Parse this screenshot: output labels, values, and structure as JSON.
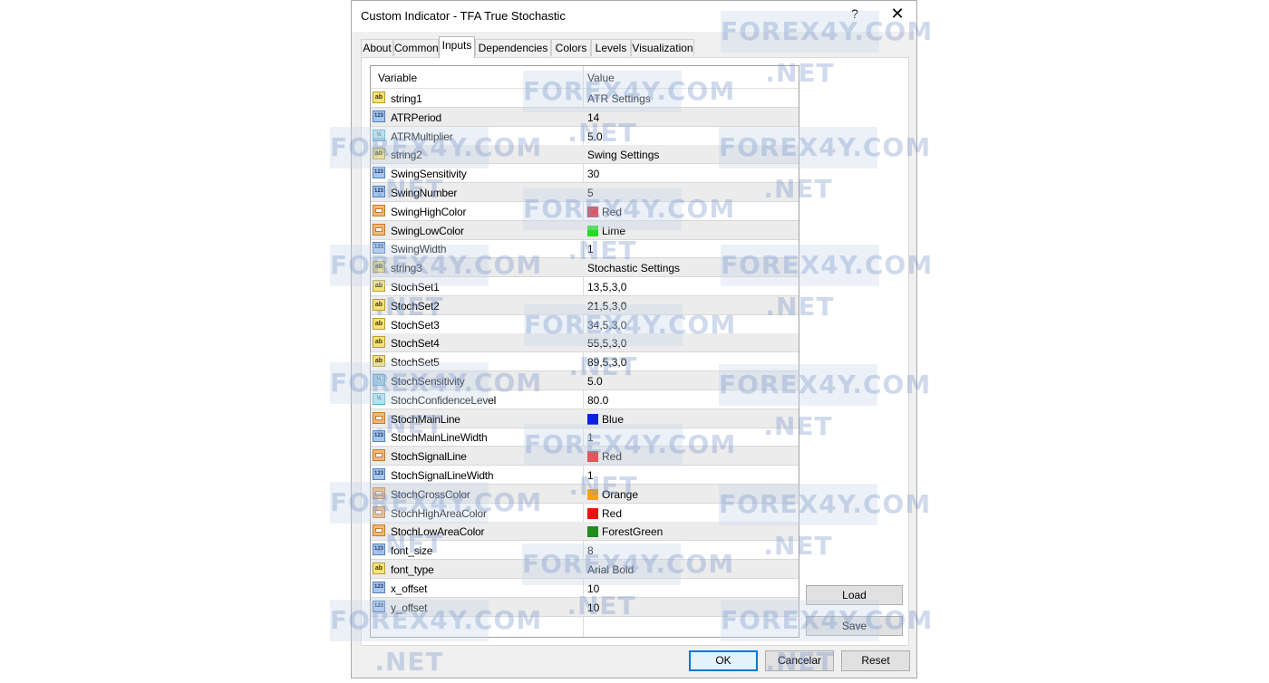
{
  "window": {
    "title": "Custom Indicator - TFA True Stochastic",
    "help": "?",
    "close": "✕"
  },
  "tabs": [
    "About",
    "Common",
    "Inputs",
    "Dependencies",
    "Colors",
    "Levels",
    "Visualization"
  ],
  "active_tab": "Inputs",
  "grid": {
    "headers": {
      "variable": "Variable",
      "value": "Value"
    },
    "rows": [
      {
        "type": "string",
        "icon": "ab",
        "name": "string1",
        "value": "ATR Settings"
      },
      {
        "type": "int",
        "icon": "123",
        "name": "ATRPeriod",
        "value": "14"
      },
      {
        "type": "double",
        "icon": "½",
        "name": "ATRMultiplier",
        "value": "5.0"
      },
      {
        "type": "string",
        "icon": "ab",
        "name": "string2",
        "value": "Swing Settings"
      },
      {
        "type": "int",
        "icon": "123",
        "name": "SwingSensitivity",
        "value": "30"
      },
      {
        "type": "int",
        "icon": "123",
        "name": "SwingNumber",
        "value": "5"
      },
      {
        "type": "color",
        "icon": "",
        "name": "SwingHighColor",
        "value": "Red",
        "swatch": "#ee1111"
      },
      {
        "type": "color",
        "icon": "",
        "name": "SwingLowColor",
        "value": "Lime",
        "swatch": "#22dd22"
      },
      {
        "type": "int",
        "icon": "123",
        "name": "SwingWidth",
        "value": "1"
      },
      {
        "type": "string",
        "icon": "ab",
        "name": "string3",
        "value": "Stochastic Settings"
      },
      {
        "type": "string",
        "icon": "ab",
        "name": "StochSet1",
        "value": "13,5,3,0"
      },
      {
        "type": "string",
        "icon": "ab",
        "name": "StochSet2",
        "value": "21,5,3,0"
      },
      {
        "type": "string",
        "icon": "ab",
        "name": "StochSet3",
        "value": "34,5,3,0"
      },
      {
        "type": "string",
        "icon": "ab",
        "name": "StochSet4",
        "value": "55,5,3,0"
      },
      {
        "type": "string",
        "icon": "ab",
        "name": "StochSet5",
        "value": "89,5,3,0"
      },
      {
        "type": "double",
        "icon": "½",
        "name": "StochSensitivity",
        "value": "5.0"
      },
      {
        "type": "double",
        "icon": "½",
        "name": "StochConfidenceLevel",
        "value": "80.0"
      },
      {
        "type": "color",
        "icon": "",
        "name": "StochMainLine",
        "value": "Blue",
        "swatch": "#0a1fe0"
      },
      {
        "type": "int",
        "icon": "123",
        "name": "StochMainLineWidth",
        "value": "1"
      },
      {
        "type": "color",
        "icon": "",
        "name": "StochSignalLine",
        "value": "Red",
        "swatch": "#ee1111"
      },
      {
        "type": "int",
        "icon": "123",
        "name": "StochSignalLineWidth",
        "value": "1"
      },
      {
        "type": "color",
        "icon": "",
        "name": "StochCrossColor",
        "value": "Orange",
        "swatch": "#f5a30f"
      },
      {
        "type": "color",
        "icon": "",
        "name": "StochHighAreaColor",
        "value": "Red",
        "swatch": "#ee1111"
      },
      {
        "type": "color",
        "icon": "",
        "name": "StochLowAreaColor",
        "value": "ForestGreen",
        "swatch": "#228b22"
      },
      {
        "type": "int",
        "icon": "123",
        "name": "font_size",
        "value": "8"
      },
      {
        "type": "string",
        "icon": "ab",
        "name": "font_type",
        "value": "Arial Bold"
      },
      {
        "type": "int",
        "icon": "123",
        "name": "x_offset",
        "value": "10"
      },
      {
        "type": "int",
        "icon": "123",
        "name": "y_offset",
        "value": "10"
      }
    ]
  },
  "side_buttons": {
    "load": "Load",
    "save": "Save"
  },
  "footer_buttons": {
    "ok": "OK",
    "cancel": "Cancelar",
    "reset": "Reset"
  },
  "watermark": "FOREX4Y.COM .NET"
}
